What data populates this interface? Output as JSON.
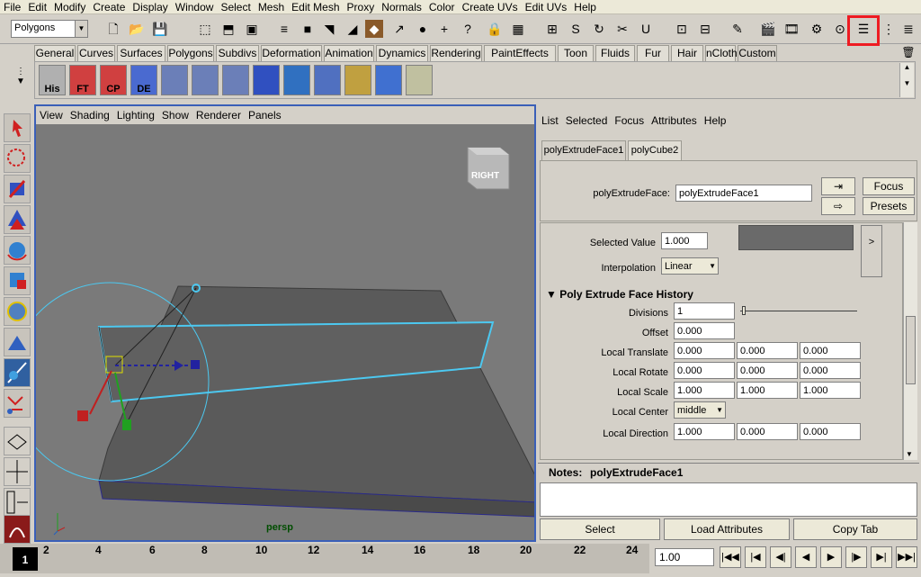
{
  "menubar": [
    "File",
    "Edit",
    "Modify",
    "Create",
    "Display",
    "Window",
    "Select",
    "Mesh",
    "Edit Mesh",
    "Proxy",
    "Normals",
    "Color",
    "Create UVs",
    "Edit UVs",
    "Help"
  ],
  "mode_selector": "Polygons",
  "shelf_tabs": [
    "General",
    "Curves",
    "Surfaces",
    "Polygons",
    "Subdivs",
    "Deformation",
    "Animation",
    "Dynamics",
    "Rendering",
    "PaintEffects",
    "Toon",
    "Fluids",
    "Fur",
    "Hair",
    "nCloth",
    "Custom"
  ],
  "active_shelf_tab": "Custom",
  "shelf_buttons": [
    "His",
    "FT",
    "CP",
    "DE"
  ],
  "viewport": {
    "menu": [
      "View",
      "Shading",
      "Lighting",
      "Show",
      "Renderer",
      "Panels"
    ],
    "camera_label": "persp",
    "viewcube_label": "RIGHT"
  },
  "attribute_editor": {
    "menu": [
      "List",
      "Selected",
      "Focus",
      "Attributes",
      "Help"
    ],
    "tabs": [
      "polyExtrudeFace1",
      "polyCube2"
    ],
    "node_label": "polyExtrudeFace:",
    "node_value": "polyExtrudeFace1",
    "focus_label": "Focus",
    "presets_label": "Presets",
    "selected_value_label": "Selected Value",
    "selected_value": "1.000",
    "interpolation_label": "Interpolation",
    "interpolation_value": "Linear",
    "section_title": "Poly Extrude Face History",
    "rows": {
      "divisions": {
        "label": "Divisions",
        "value": "1"
      },
      "offset": {
        "label": "Offset",
        "value": "0.000"
      },
      "local_translate": {
        "label": "Local Translate",
        "values": [
          "0.000",
          "0.000",
          "0.000"
        ]
      },
      "local_rotate": {
        "label": "Local Rotate",
        "values": [
          "0.000",
          "0.000",
          "0.000"
        ]
      },
      "local_scale": {
        "label": "Local Scale",
        "values": [
          "1.000",
          "1.000",
          "1.000"
        ]
      },
      "local_center": {
        "label": "Local Center",
        "value": "middle"
      },
      "local_direction": {
        "label": "Local Direction",
        "values": [
          "1.000",
          "0.000",
          "0.000"
        ]
      }
    },
    "notes_label": "Notes:",
    "notes_node": "polyExtrudeFace1",
    "buttons": {
      "select": "Select",
      "load": "Load Attributes",
      "copy": "Copy Tab"
    }
  },
  "timeline": {
    "current_frame": "1",
    "ticks": [
      "2",
      "4",
      "6",
      "8",
      "10",
      "12",
      "14",
      "16",
      "18",
      "20",
      "22",
      "24"
    ],
    "time_value": "1.00"
  },
  "colors": {
    "viewport_bg": "#7a7a7a",
    "mesh": "#5a5a5a",
    "selection": "#4cc8f0",
    "highlight": "#ee1b22"
  }
}
